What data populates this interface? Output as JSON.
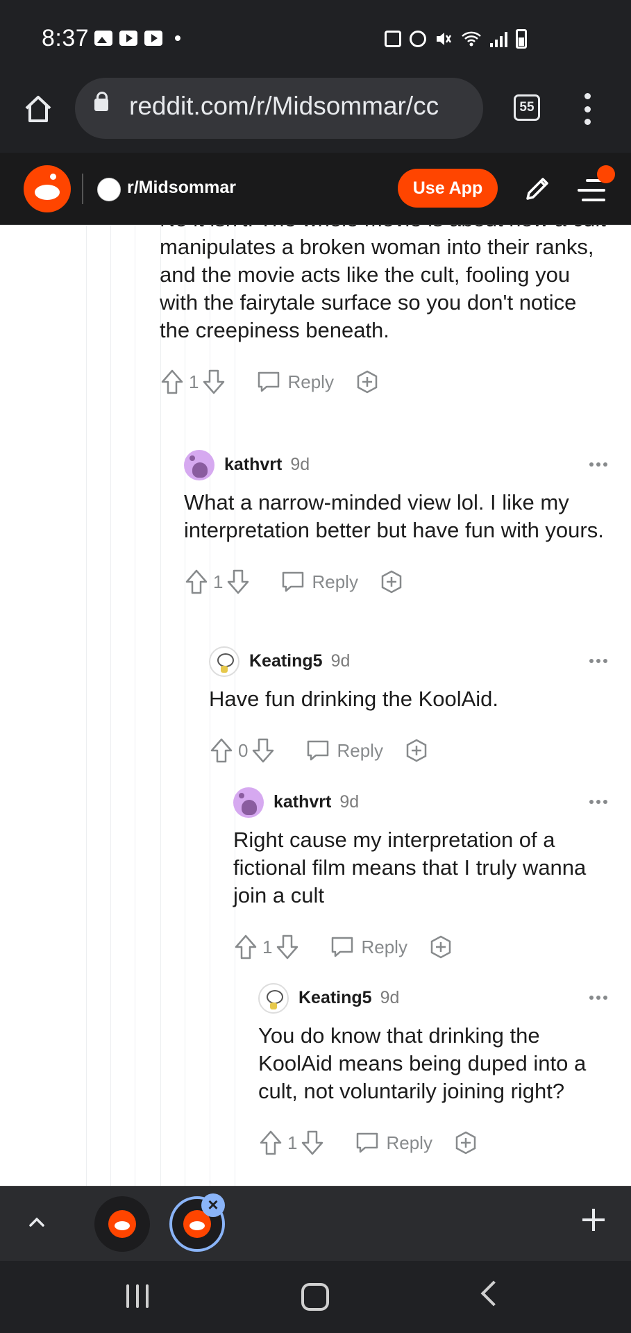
{
  "status_bar": {
    "time": "8:37"
  },
  "browser": {
    "url": "reddit.com/r/Midsommar/cc",
    "tab_count": "55"
  },
  "reddit_header": {
    "subreddit": "r/Midsommar",
    "use_app_label": "Use App",
    "brand_color": "#ff4500"
  },
  "comments": [
    {
      "body": "No it isn't. The whole movie is about how a cult manipulates a broken woman into their ranks, and the movie acts like the cult, fooling you with the fairytale surface so you don't notice the creepiness beneath.",
      "votes": "1",
      "reply_label": "Reply"
    },
    {
      "user": "kathvrt",
      "time": "9d",
      "body": "What a narrow-minded view lol. I like my interpretation better but have fun with yours.",
      "votes": "1",
      "reply_label": "Reply"
    },
    {
      "user": "Keating5",
      "time": "9d",
      "body": "Have fun drinking the KoolAid.",
      "votes": "0",
      "reply_label": "Reply"
    },
    {
      "user": "kathvrt",
      "time": "9d",
      "body": "Right cause my interpretation of a fictional film means that I truly wanna join a cult",
      "votes": "1",
      "reply_label": "Reply"
    },
    {
      "user": "Keating5",
      "time": "9d",
      "body": "You do know that drinking the KoolAid means being duped into a cult, not voluntarily joining right?",
      "votes": "1",
      "reply_label": "Reply"
    }
  ],
  "icons": {
    "home": "home-icon",
    "lock": "lock-icon",
    "upvote": "upvote-arrow-icon",
    "downvote": "downvote-arrow-icon",
    "reply": "speech-bubble-icon",
    "award": "award-plus-icon",
    "more": "more-dots-icon"
  }
}
